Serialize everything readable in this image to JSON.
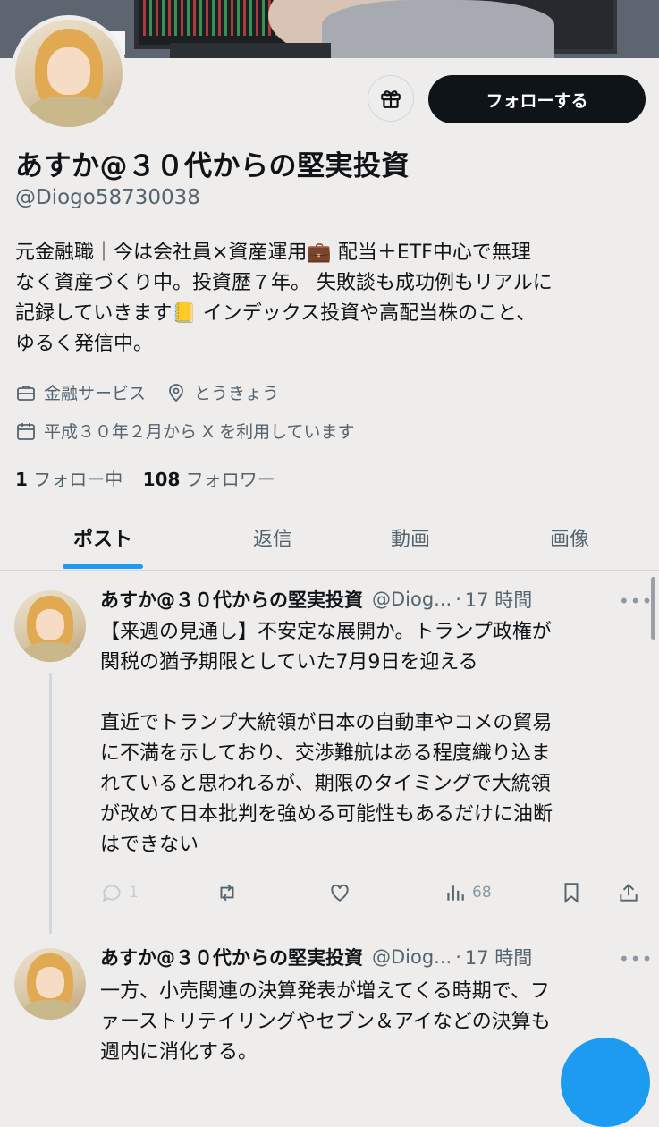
{
  "profile": {
    "display_name": "あすか@３０代からの堅実投資",
    "handle": "@Diogo58730038",
    "bio": "元金融職｜今は会社員×資産運用💼 配当＋ETF中心で無理\nなく資産づくり中。投資歴７年。 失敗談も成功例もリアルに\n記録していきます📒 インデックス投資や高配当株のこと、\nゆるく発信中。",
    "category": "金融サービス",
    "location": "とうきょう",
    "joined": "平成３０年２月から X を利用しています",
    "following_count": "1",
    "following_label": "フォロー中",
    "followers_count": "108",
    "followers_label": "フォロワー"
  },
  "header": {
    "follow_button": "フォローする"
  },
  "tabs": [
    {
      "label": "ポスト",
      "active": true
    },
    {
      "label": "返信",
      "active": false
    },
    {
      "label": "動画",
      "active": false
    },
    {
      "label": "画像",
      "active": false
    }
  ],
  "tweets": [
    {
      "name": "あすか@３０代からの堅実投資",
      "handle": "@Diog...",
      "dot": "·",
      "time": "17 時間",
      "more": "•••",
      "text": "【来週の見通し】不安定な展開か。トランプ政権が\n関税の猶予期限としていた7月9日を迎える\n\n直近でトランプ大統領が日本の自動車やコメの貿易\nに不満を示しており、交渉難航はある程度織り込ま\nれていると思われるが、期限のタイミングで大統領\nが改めて日本批判を強める可能性もあるだけに油断\nはできない",
      "replies": "1",
      "views": "68"
    },
    {
      "name": "あすか@３０代からの堅実投資",
      "handle": "@Diog...",
      "dot": "·",
      "time": "17 時間",
      "more": "•••",
      "text": "一方、小売関連の決算発表が増えてくる時期で、フ\nァーストリテイリングやセブン＆アイなどの決算も\n週内に消化する。"
    }
  ],
  "icons": [
    "gift-icon",
    "briefcase-icon",
    "location-pin-icon",
    "calendar-icon",
    "reply-icon",
    "retweet-icon",
    "like-icon",
    "views-icon",
    "bookmark-icon",
    "share-icon",
    "compose-icon"
  ],
  "colors": {
    "accent": "#1d9bf0",
    "text": "#0f1419",
    "secondary": "#536471",
    "background": "#efedeb"
  }
}
